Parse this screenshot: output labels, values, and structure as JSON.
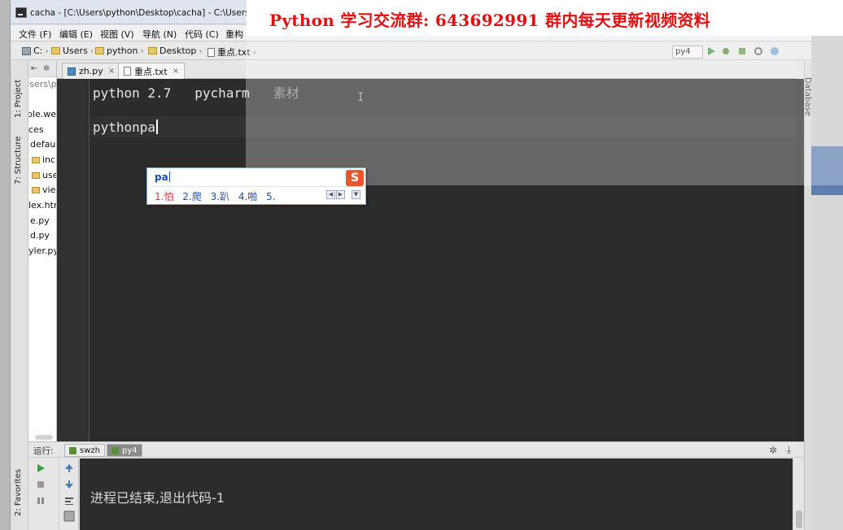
{
  "window": {
    "title": "cacha - [C:\\Users\\python\\Desktop\\cacha] - C:\\Users\\pytho"
  },
  "menu": [
    {
      "label": "文件 (F)"
    },
    {
      "label": "编辑 (E)"
    },
    {
      "label": "视图 (V)"
    },
    {
      "label": "导航 (N)"
    },
    {
      "label": "代码 (C)"
    },
    {
      "label": "重构"
    }
  ],
  "breadcrumb": [
    {
      "label": "C:",
      "icon": "drive-icon"
    },
    {
      "label": "Users",
      "icon": "folder-icon"
    },
    {
      "label": "python",
      "icon": "folder-icon"
    },
    {
      "label": "Desktop",
      "icon": "folder-icon"
    },
    {
      "label": "重点.txt",
      "icon": "text-file-icon"
    }
  ],
  "toolbar": {
    "run_config": "py4"
  },
  "side_tools": {
    "project": "1: Project",
    "structure": "7: Structure",
    "favorites": "2: Favorites",
    "database": "Database"
  },
  "project_panel": {
    "items": [
      {
        "label": "Jsers\\py",
        "kind": "path"
      },
      {
        "label": "ple.we",
        "kind": "file"
      },
      {
        "label": "ces",
        "kind": "file"
      },
      {
        "label": "defau",
        "kind": "file"
      },
      {
        "label": "inc",
        "kind": "folder"
      },
      {
        "label": "use",
        "kind": "folder"
      },
      {
        "label": "vie",
        "kind": "folder"
      },
      {
        "label": "lex.htr",
        "kind": "file"
      },
      {
        "label": "e.py",
        "kind": "file"
      },
      {
        "label": "d.py",
        "kind": "file"
      },
      {
        "label": "yler.py",
        "kind": "file"
      }
    ]
  },
  "tabs": [
    {
      "label": "zh.py",
      "icon": "python-file-icon",
      "active": false
    },
    {
      "label": "重点.txt",
      "icon": "text-file-icon",
      "active": true
    }
  ],
  "editor": {
    "line1": {
      "part1": "python 2.7   pycharm   ",
      "part2": "素材"
    },
    "line2": "pythonpa"
  },
  "ime": {
    "composition": "pa",
    "logo": "S",
    "candidates": [
      "1.怕",
      "2.爬",
      "3.趴",
      "4.啪",
      "5."
    ]
  },
  "run_panel": {
    "label": "运行:",
    "tabs": [
      {
        "label": "swzh",
        "active": false
      },
      {
        "label": "py4",
        "active": true
      }
    ],
    "output": "进程已结束,退出代码-1"
  },
  "banner": {
    "text": "Python 学习交流群: 643692991 群内每天更新视频资料",
    "color": "#e01010"
  }
}
